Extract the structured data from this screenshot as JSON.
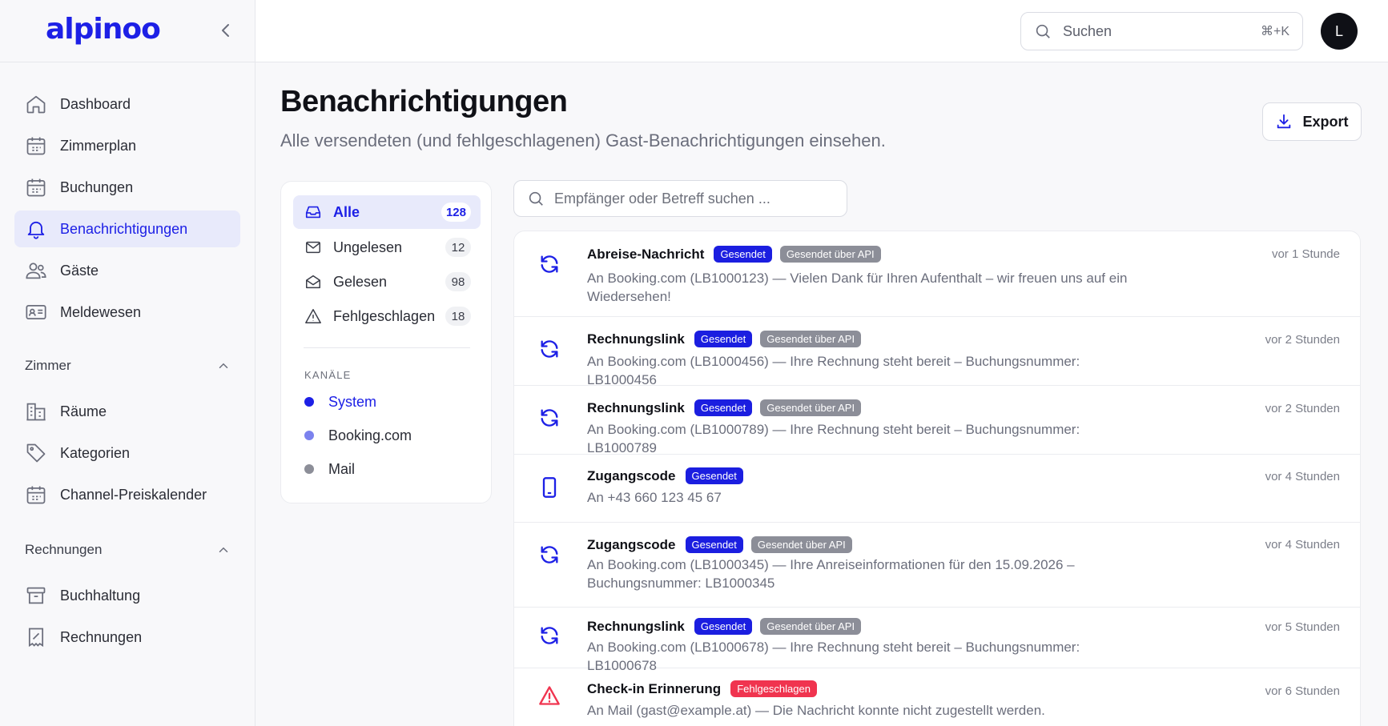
{
  "brand": {
    "logo_text": "alpinoo",
    "color": "#1d20e6"
  },
  "sidebar": {
    "items": [
      {
        "label": "Dashboard",
        "icon": "home-icon"
      },
      {
        "label": "Zimmerplan",
        "icon": "calendar-icon"
      },
      {
        "label": "Buchungen",
        "icon": "calendar-icon"
      },
      {
        "label": "Benachrichtigungen",
        "icon": "bell-icon",
        "active": true
      },
      {
        "label": "Gäste",
        "icon": "users-icon"
      },
      {
        "label": "Meldewesen",
        "icon": "id-card-icon"
      }
    ],
    "sections": [
      {
        "label": "Zimmer",
        "items": [
          {
            "label": "Räume",
            "icon": "building-icon"
          },
          {
            "label": "Kategorien",
            "icon": "tag-icon"
          },
          {
            "label": "Channel-Preiskalender",
            "icon": "calendar-icon"
          }
        ]
      },
      {
        "label": "Rechnungen",
        "items": [
          {
            "label": "Buchhaltung",
            "icon": "archive-icon"
          },
          {
            "label": "Rechnungen",
            "icon": "receipt-icon"
          }
        ]
      }
    ]
  },
  "topbar": {
    "search_placeholder": "Suchen",
    "search_shortcut": "⌘+K",
    "avatar_initial": "L"
  },
  "page": {
    "title": "Benachrichtigungen",
    "subtitle": "Alle versendeten (und fehlgeschlagenen) Gast-Benachrichtigungen einsehen.",
    "export_label": "Export"
  },
  "filters": {
    "items": [
      {
        "label": "Alle",
        "count": "128",
        "icon": "inbox-icon",
        "active": true
      },
      {
        "label": "Ungelesen",
        "count": "12",
        "icon": "mail-icon"
      },
      {
        "label": "Gelesen",
        "count": "98",
        "icon": "mail-open-icon"
      },
      {
        "label": "Fehlgeschlagen",
        "count": "18",
        "icon": "warning-icon"
      }
    ],
    "channels_label": "KANÄLE",
    "channels": [
      {
        "label": "System",
        "color": "#1d20e6",
        "active": true
      },
      {
        "label": "Booking.com",
        "color": "#7b82ee"
      },
      {
        "label": "Mail",
        "color": "#8c8e98"
      }
    ]
  },
  "list_search_placeholder": "Empfänger oder Betreff suchen ...",
  "notifications": [
    {
      "icon": "sync-icon",
      "title": "Abreise-Nachricht",
      "badges": [
        "Gesendet",
        "Gesendet über API"
      ],
      "message": "An Booking.com (LB1000123) — Vielen Dank für Ihren Aufenthalt – wir freuen uns auf ein Wiedersehen!",
      "time": "vor 1 Stunde"
    },
    {
      "icon": "sync-icon",
      "title": "Rechnungslink",
      "badges": [
        "Gesendet",
        "Gesendet über API"
      ],
      "message": "An Booking.com (LB1000456) — Ihre Rechnung steht bereit – Buchungsnummer: LB1000456",
      "time": "vor 2 Stunden"
    },
    {
      "icon": "sync-icon",
      "title": "Rechnungslink",
      "badges": [
        "Gesendet",
        "Gesendet über API"
      ],
      "message": "An Booking.com (LB1000789) — Ihre Rechnung steht bereit – Buchungsnummer: LB1000789",
      "time": "vor 2 Stunden"
    },
    {
      "icon": "phone-icon",
      "title": "Zugangscode",
      "badges": [
        "Gesendet"
      ],
      "message": "An +43 660 123 45 67",
      "time": "vor 4 Stunden"
    },
    {
      "icon": "sync-icon",
      "title": "Zugangscode",
      "badges": [
        "Gesendet",
        "Gesendet über API"
      ],
      "message": "An Booking.com (LB1000345) — Ihre Anreiseinformationen für den 15.09.2026 – Buchungsnummer: LB1000345",
      "time": "vor 4 Stunden"
    },
    {
      "icon": "sync-icon",
      "title": "Rechnungslink",
      "badges": [
        "Gesendet",
        "Gesendet über API"
      ],
      "message": "An Booking.com (LB1000678) — Ihre Rechnung steht bereit – Buchungsnummer: LB1000678",
      "time": "vor 5 Stunden"
    },
    {
      "icon": "warning-icon",
      "title": "Check-in Erinnerung",
      "badges": [
        "Fehlgeschlagen"
      ],
      "message": "An Mail (gast@example.at) — Die Nachricht konnte nicht zugestellt werden.",
      "time": "vor 6 Stunden"
    }
  ]
}
